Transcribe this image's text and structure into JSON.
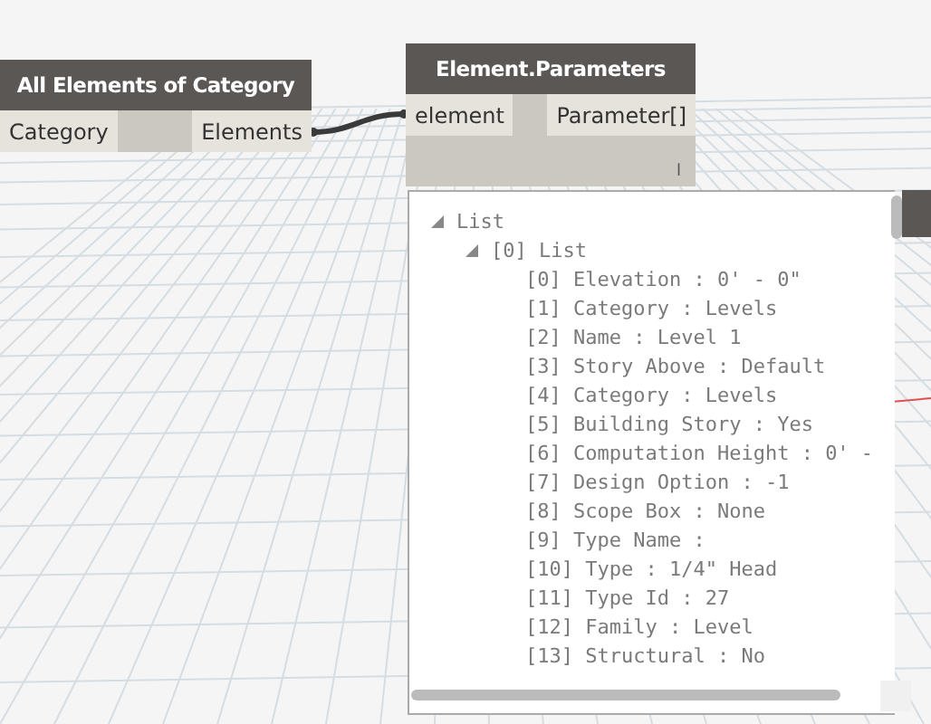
{
  "nodes": [
    {
      "title": "All Elements of Category",
      "inputs": [
        "Category"
      ],
      "outputs": [
        "Elements"
      ]
    },
    {
      "title": "Element.Parameters",
      "inputs": [
        "element"
      ],
      "outputs": [
        "Parameter[]"
      ],
      "lacing": "l"
    }
  ],
  "preview": {
    "label": "List",
    "expanded": true,
    "children": [
      {
        "label": "[0] List",
        "expanded": true,
        "children": [
          {
            "label": "[0] Elevation : 0' - 0\""
          },
          {
            "label": "[1] Category : Levels"
          },
          {
            "label": "[2] Name : Level 1"
          },
          {
            "label": "[3] Story Above : Default"
          },
          {
            "label": "[4] Category : Levels"
          },
          {
            "label": "[5] Building Story : Yes"
          },
          {
            "label": "[6] Computation Height : 0' -"
          },
          {
            "label": "[7] Design Option : -1"
          },
          {
            "label": "[8] Scope Box : None"
          },
          {
            "label": "[9] Type Name :"
          },
          {
            "label": "[10] Type : 1/4\" Head"
          },
          {
            "label": "[11] Type Id : 27"
          },
          {
            "label": "[12] Family : Level"
          },
          {
            "label": "[13] Structural : No"
          }
        ]
      }
    ]
  }
}
